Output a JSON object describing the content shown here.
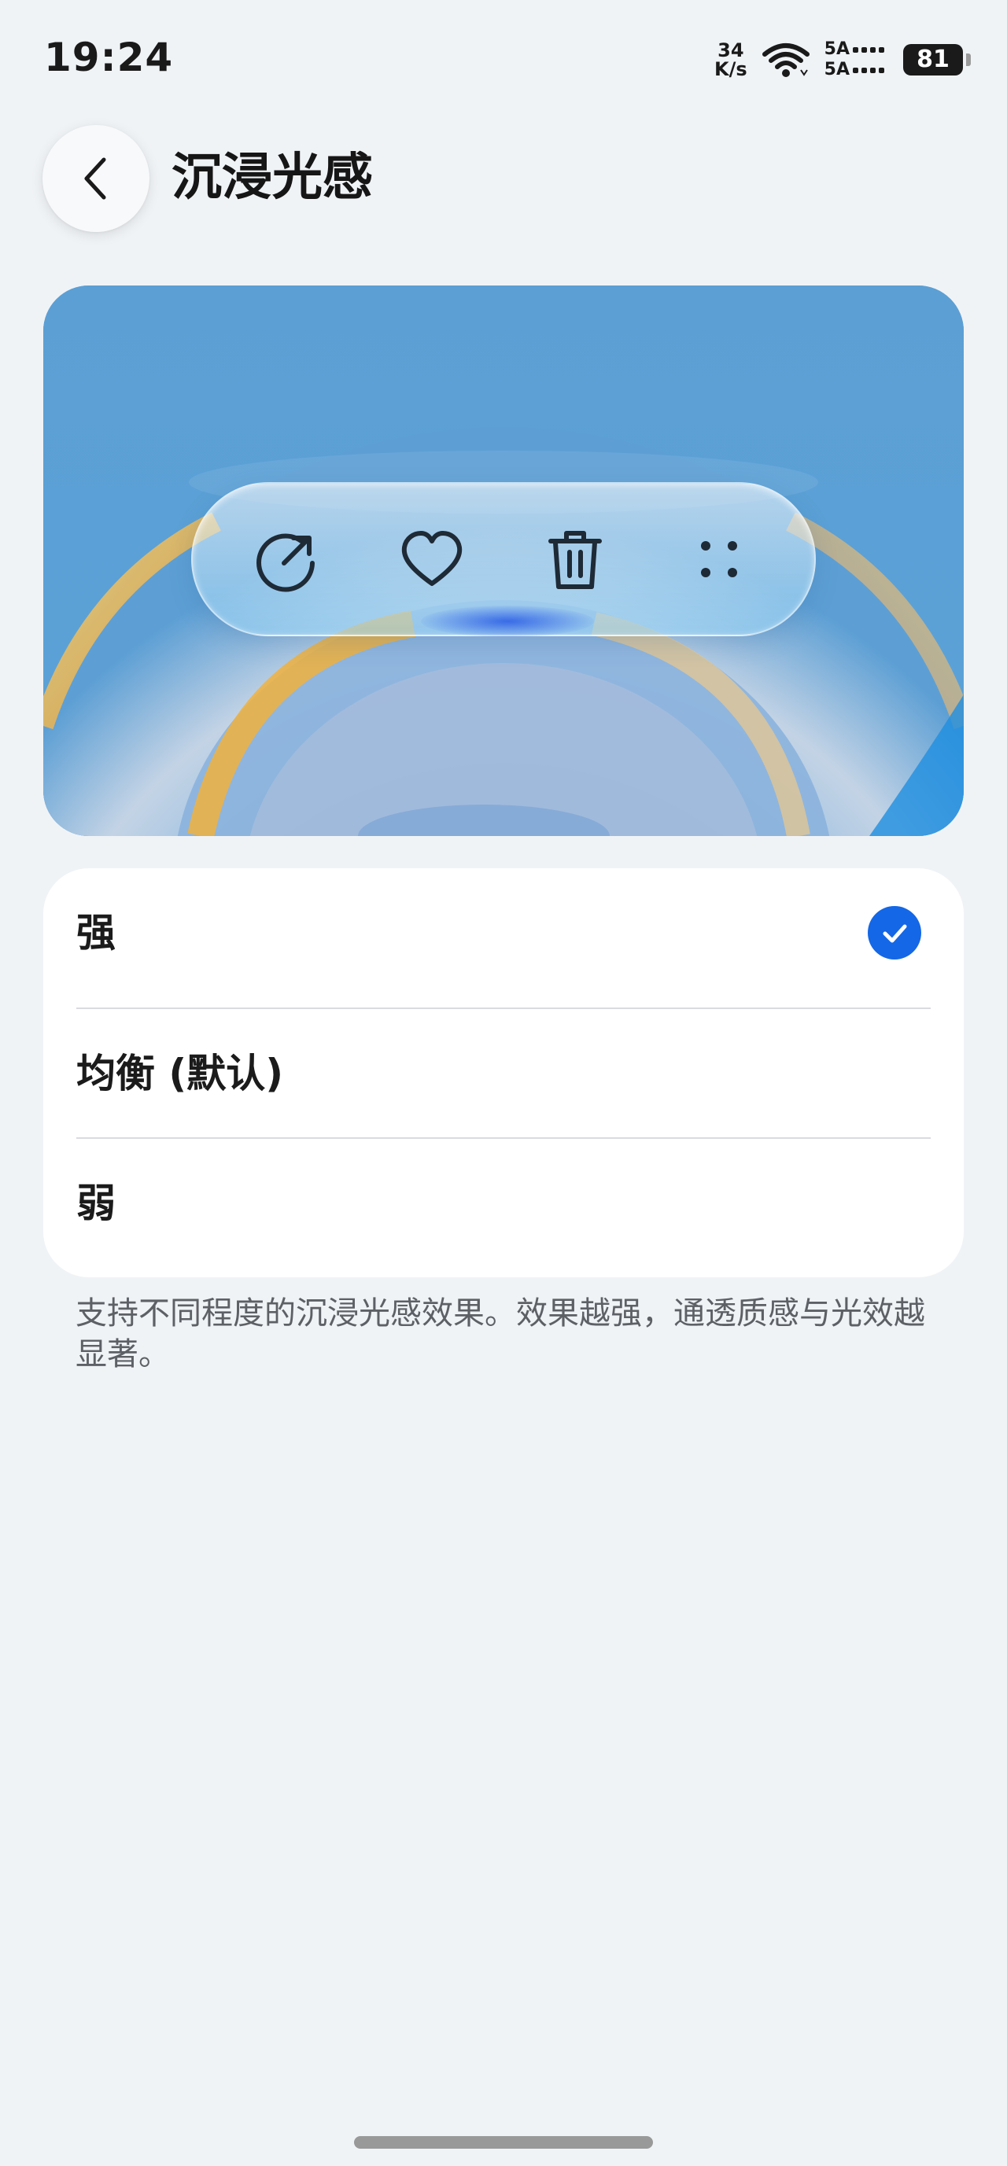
{
  "status_bar": {
    "time": "19:24",
    "net_speed_value": "34",
    "net_speed_unit": "K/s",
    "signal_1_label": "5A",
    "signal_2_label": "5A",
    "battery_level": "81"
  },
  "header": {
    "title": "沉浸光感"
  },
  "preview": {
    "toolbar_icons": [
      "share-icon",
      "heart-icon",
      "trash-icon",
      "more-dots-icon"
    ]
  },
  "options": {
    "items": [
      {
        "label": "强",
        "selected": true
      },
      {
        "label": "均衡 (默认)",
        "selected": false
      },
      {
        "label": "弱",
        "selected": false
      }
    ]
  },
  "description": "支持不同程度的沉浸光感效果。效果越强，通透质感与光效越显著。",
  "colors": {
    "accent": "#1467e6",
    "background": "#f0f3f6",
    "card": "#ffffff",
    "preview_blue": "#5a9fd5"
  }
}
